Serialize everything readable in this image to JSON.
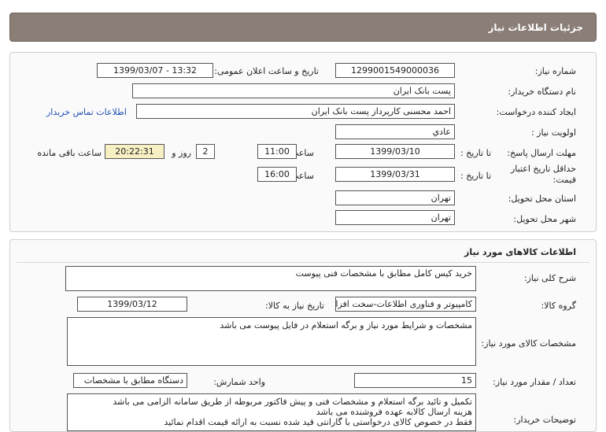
{
  "header": {
    "title": "جزئیات اطلاعات نیاز"
  },
  "info": {
    "need_number_label": "شماره نیاز:",
    "need_number": "1299001549000036",
    "announce_label": "تاریخ و ساعت اعلان عمومی:",
    "announce_value": "1399/03/07 - 13:32",
    "buyer_org_label": "نام دستگاه خریدار:",
    "buyer_org": "پست بانک ایران",
    "creator_label": "ایجاد کننده درخواست:",
    "creator": "احمد  محسنی کارپرداز پست بانک ایران",
    "contact_link": "اطلاعات تماس خریدار",
    "priority_label": "اولویت نیاز :",
    "priority": "عادي",
    "deadline_label": "مهلت ارسال پاسخ:",
    "until_label": "تا تاریخ :",
    "deadline_date": "1399/03/10",
    "time_label": "ساعت",
    "deadline_time": "11:00",
    "days": "2",
    "days_label": "روز و",
    "remaining": "20:22:31",
    "remaining_label": "ساعت باقی مانده",
    "validity_label": "حداقل تاریخ اعتبار قیمت:",
    "validity_until_label": "تا تاریخ :",
    "validity_date": "1399/03/31",
    "validity_time_label": "ساعت",
    "validity_time": "16:00",
    "province_label": "استان محل تحویل:",
    "province": "تهران",
    "city_label": "شهر محل تحویل:",
    "city": "تهران"
  },
  "goods": {
    "section_title": "اطلاعات کالاهای مورد نیاز",
    "summary_label": "شرح کلی نیاز:",
    "summary": "خرید کیس کامل مطابق با مشخصات فنی پیوست",
    "group_label": "گروه کالا:",
    "group": "کامپیوتر و فناوری اطلاعات-سخت افزار",
    "need_date_label": "تاریخ نیاز به کالا:",
    "need_date": "1399/03/12",
    "spec_label": "مشخصات کالای مورد نیاز:",
    "spec": "مشخصات و شرایط مورد نیاز و برگه استعلام در فایل پیوست می باشد",
    "qty_label": "تعداد / مقدار مورد نیاز:",
    "qty": "15",
    "unit_label": "واحد شمارش:",
    "unit": "دستگاه مطابق با مشخصات",
    "buyer_notes_label": "توضیحات خریدار:",
    "buyer_notes": [
      "تکمیل و تائید برگه استعلام و مشخصات فنی و پیش فاکتور مربوطه از طریق سامانه الزامی می باشد",
      "هزینه ارسال کالابه عهده فروشنده می باشد",
      "فقط در خصوص کالای درخواستی با گارانتی قید شده نسبت به ارائه قیمت اقدام نمائید"
    ]
  }
}
